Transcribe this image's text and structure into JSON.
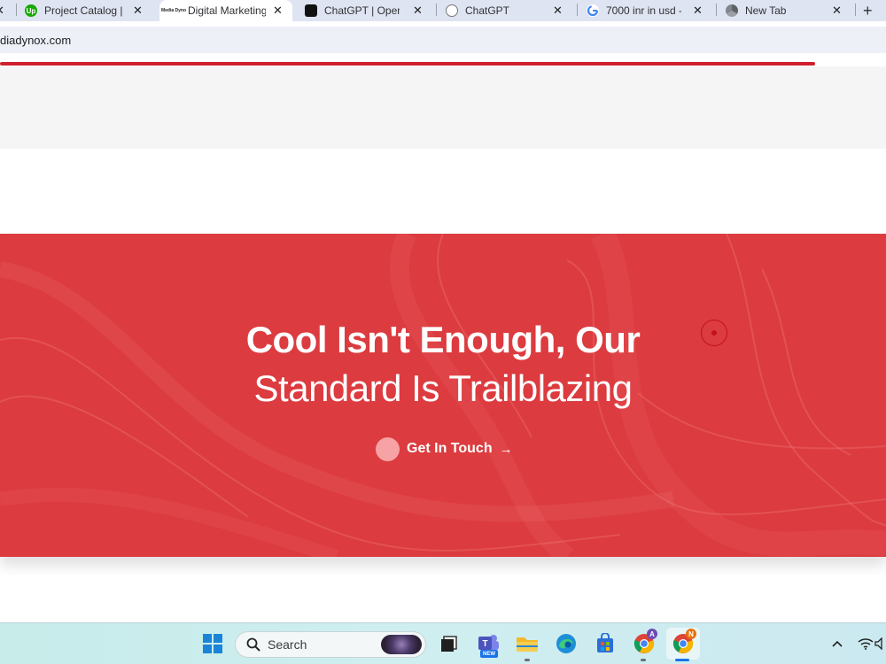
{
  "browser": {
    "tabs": [
      {
        "title": "Project Catalog |",
        "favicon": "upwork-icon"
      },
      {
        "title": "Digital Marketing",
        "favicon": "site-icon",
        "active": true
      },
      {
        "title": "ChatGPT | Open",
        "favicon": "openai-icon"
      },
      {
        "title": "ChatGPT",
        "favicon": "openai-icon"
      },
      {
        "title": "7000 inr in usd -",
        "favicon": "google-icon"
      },
      {
        "title": "New Tab",
        "favicon": "chrome-icon"
      }
    ],
    "favicon_labels": {
      "upwork": "Up",
      "site": "Media Dyno"
    },
    "new_tab_symbol": "+",
    "close_symbol": "✕",
    "address": "diadynox.com",
    "progress_color": "#d0202d"
  },
  "hero": {
    "line1": "Cool Isn't Enough, Our",
    "line2": "Standard Is Trailblazing",
    "cta_label": "Get In Touch",
    "cta_arrow": "→",
    "background_color": "#dc3b3f"
  },
  "taskbar": {
    "search_label": "Search",
    "teams_badge": "NEW",
    "chrome_profile_a": "A",
    "chrome_profile_n": "N"
  }
}
